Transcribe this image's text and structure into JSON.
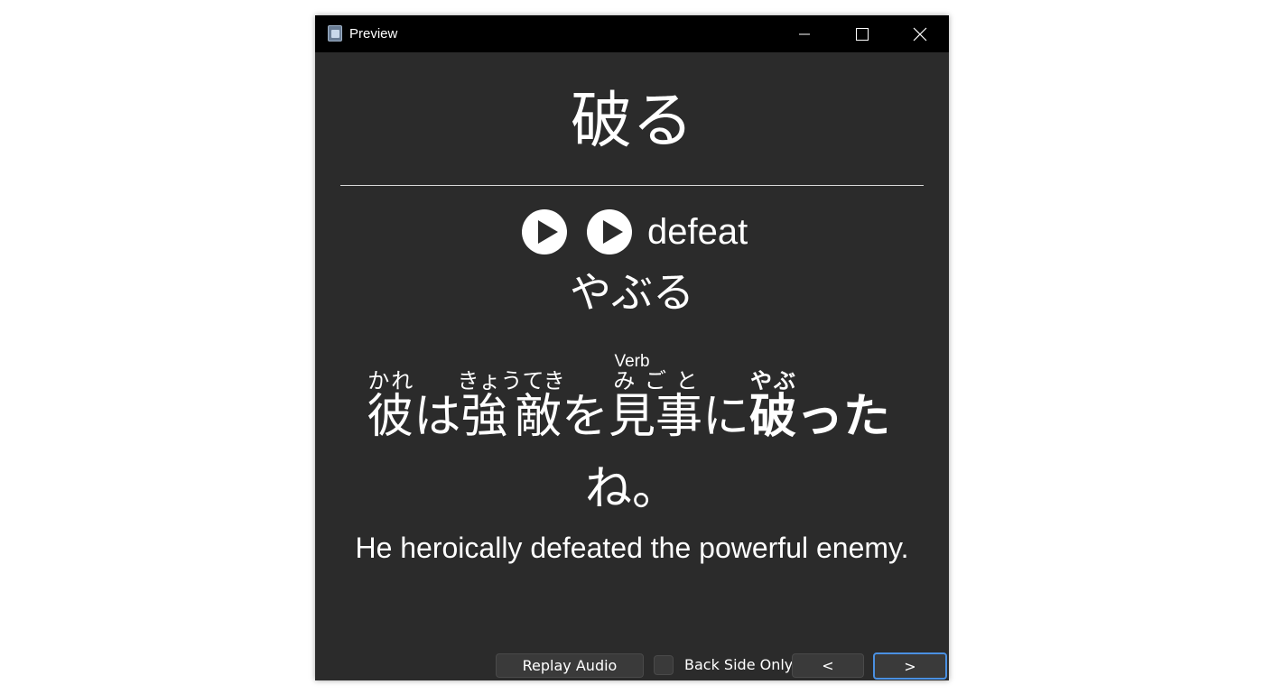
{
  "window": {
    "title": "Preview",
    "controls": [
      "minimize-icon",
      "maximize-icon",
      "close-icon"
    ]
  },
  "card": {
    "headword": "破る",
    "meaning": "defeat",
    "reading": "やぶる",
    "part_of_speech": "Verb",
    "sentence": {
      "segments": [
        {
          "text": "彼",
          "furigana": "かれ"
        },
        {
          "text": "は",
          "furigana": ""
        },
        {
          "text": "強敵",
          "furigana": "きょうてき"
        },
        {
          "text": "を",
          "furigana": ""
        },
        {
          "text": "見事",
          "furigana": "みごと"
        },
        {
          "text": "に",
          "furigana": ""
        },
        {
          "text": "破",
          "furigana": "やぶ"
        },
        {
          "text": "った",
          "furigana": ""
        },
        {
          "text": "ね。",
          "furigana": ""
        }
      ]
    },
    "translation": "He heroically defeated the powerful enemy."
  },
  "controls": {
    "replay_label": "Replay Audio",
    "back_side_label": "Back Side Only",
    "back_side_checked": false,
    "prev_label": "<",
    "next_label": ">"
  },
  "colors": {
    "background": "#2b2b2b",
    "titlebar": "#000000",
    "text": "#ffffff",
    "focus_border": "#4a90e2"
  }
}
